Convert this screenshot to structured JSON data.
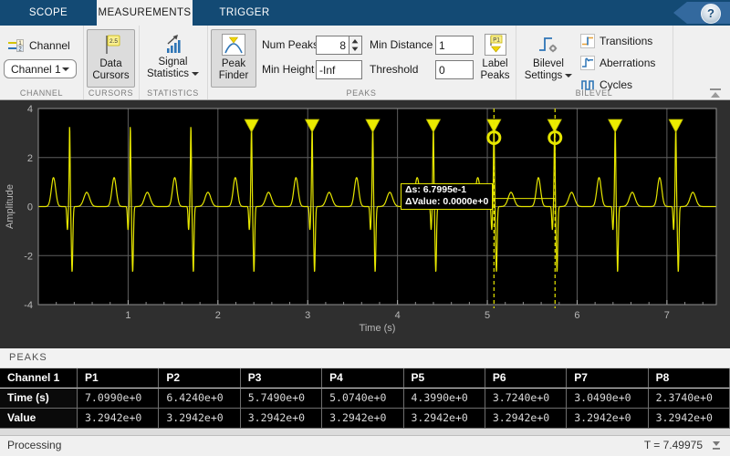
{
  "window": {
    "tabs": [
      {
        "label": "SCOPE",
        "active": false
      },
      {
        "label": "MEASUREMENTS",
        "active": true
      },
      {
        "label": "TRIGGER",
        "active": false
      }
    ],
    "help_glyph": "?"
  },
  "colors": {
    "tabbar_blue": "#134a74",
    "toolbar_bg": "#f0f0f0",
    "signal_yellow": "#e6e600",
    "plot_bg": "#000000",
    "icon_blue": "#2e75b6",
    "icon_orange": "#e8a33d"
  },
  "toolbar": {
    "channel": {
      "button_label": "Channel",
      "dropdown_value": "Channel 1",
      "icon_rows": [
        "1",
        "2"
      ],
      "section": "CHANNEL"
    },
    "cursors": {
      "button_label": "Data Cursors",
      "flag_value": "2.5",
      "section": "CURSORS"
    },
    "statistics": {
      "button_label": "Signal Statistics",
      "section": "STATISTICS"
    },
    "peaks": {
      "finder_label": "Peak Finder",
      "num_peaks_label": "Num Peaks",
      "num_peaks_value": "8",
      "min_height_label": "Min Height",
      "min_height_value": "-Inf",
      "min_distance_label": "Min Distance",
      "min_distance_value": "1",
      "threshold_label": "Threshold",
      "threshold_value": "0",
      "label_peaks_label": "Label Peaks",
      "label_peaks_tag": "P1",
      "section": "PEAKS"
    },
    "bilevel": {
      "settings_label": "Bilevel Settings",
      "items": [
        "Transitions",
        "Aberrations",
        "Cycles"
      ],
      "section": "BILEVEL"
    }
  },
  "chart_data": {
    "type": "line",
    "title": "",
    "xlabel": "Time (s)",
    "ylabel": "Amplitude",
    "xlim": [
      0,
      7.55
    ],
    "ylim": [
      -4,
      4
    ],
    "xticks": [
      1,
      2,
      3,
      4,
      5,
      6,
      7
    ],
    "yticks": [
      -4,
      -2,
      0,
      2,
      4
    ],
    "grid": true,
    "legend": "none",
    "signal_color": "#e6e600",
    "background": "#000000",
    "signal": {
      "description": "Synthetic ECG waveform, 11 beats",
      "first_beat_time": 0.349,
      "beat_period": 0.675,
      "num_beats": 11,
      "components": {
        "p_wave": {
          "offset": -0.18,
          "sigma": 0.034,
          "amp": 1.18
        },
        "q_wave": {
          "offset": -0.025,
          "sigma": 0.009,
          "amp": -0.95
        },
        "r_wave": {
          "offset": 0.0,
          "sigma": 0.008,
          "amp": 3.3
        },
        "s_wave": {
          "offset": 0.027,
          "sigma": 0.011,
          "amp": -2.68
        },
        "t_wave": {
          "offset": 0.19,
          "sigma": 0.045,
          "amp": 0.58
        }
      }
    },
    "peak_markers": {
      "times": [
        2.374,
        3.049,
        3.724,
        4.399,
        5.074,
        5.749,
        6.424,
        7.099
      ],
      "value": 3.2942
    },
    "cursors": {
      "x1": 5.074,
      "x2": 5.754,
      "tooltip_line1": "Δs: 6.7995e-1",
      "tooltip_line2": "ΔValue: 0.0000e+0",
      "connector_y": 0.33
    }
  },
  "peaks_panel": {
    "title": "PEAKS",
    "columns": [
      "Channel 1",
      "P1",
      "P2",
      "P3",
      "P4",
      "P5",
      "P6",
      "P7",
      "P8"
    ],
    "rows": [
      {
        "label": "Time (s)",
        "values": [
          "7.0990e+0",
          "6.4240e+0",
          "5.7490e+0",
          "5.0740e+0",
          "4.3990e+0",
          "3.7240e+0",
          "3.0490e+0",
          "2.3740e+0"
        ]
      },
      {
        "label": "Value",
        "values": [
          "3.2942e+0",
          "3.2942e+0",
          "3.2942e+0",
          "3.2942e+0",
          "3.2942e+0",
          "3.2942e+0",
          "3.2942e+0",
          "3.2942e+0"
        ]
      }
    ]
  },
  "status_bar": {
    "left": "Processing",
    "right": "T = 7.49975"
  }
}
